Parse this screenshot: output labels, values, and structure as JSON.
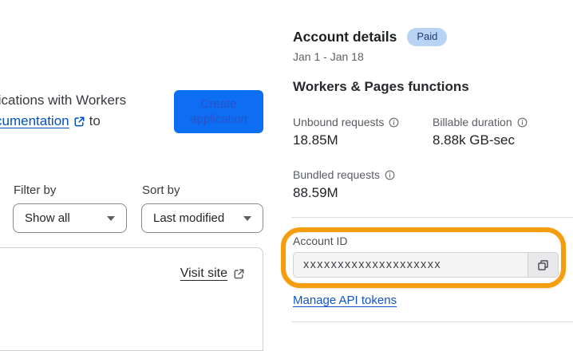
{
  "colors": {
    "accent_blue": "#0d6ef4",
    "link_blue": "#0051c3",
    "badge_bg": "#b8d3f3",
    "badge_text": "#1e3c70",
    "annotation_orange": "#f69d0f",
    "input_bg": "#f4f4f5"
  },
  "left_pane": {
    "intro_line1": "lications with Workers",
    "intro_link": "cumentation",
    "intro_suffix": "to",
    "create_button": "Create application",
    "filter_label": "Filter by",
    "filter_value": "Show all",
    "sort_label": "Sort by",
    "sort_value": "Last modified",
    "visit_site": "Visit site"
  },
  "account": {
    "title": "Account details",
    "plan_badge": "Paid",
    "date_range": "Jan 1 - Jan 18",
    "section_title": "Workers & Pages functions",
    "metrics": [
      {
        "label": "Unbound requests",
        "value": "18.85M"
      },
      {
        "label": "Billable duration",
        "value": "8.88k GB-sec"
      },
      {
        "label": "Bundled requests",
        "value": "88.59M"
      }
    ],
    "account_id": {
      "label": "Account ID",
      "value": "xxxxxxxxxxxxxxxxxxxx"
    },
    "manage_link": "Manage API tokens"
  },
  "icons": {
    "external_link": "external-link-icon",
    "info": "info-icon",
    "copy": "copy-icon",
    "chevron_down": "chevron-down-icon"
  }
}
